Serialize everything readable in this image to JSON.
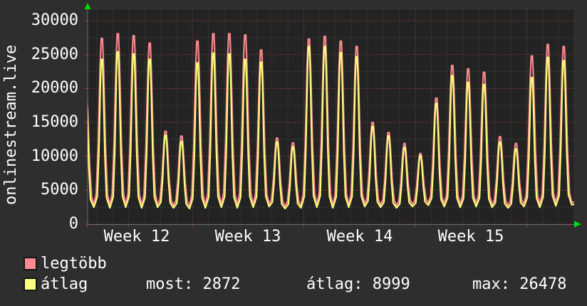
{
  "title": "onlinestream.live",
  "legend": {
    "series": [
      {
        "label": "legtöbb",
        "swatch_color": "#fb8a8e"
      },
      {
        "label": "átlag",
        "swatch_color": "#fdfd82"
      }
    ],
    "stats": [
      {
        "label": "most",
        "value": 2872,
        "text": "most: 2872"
      },
      {
        "label": "átlag",
        "value": 8999,
        "text": "átlag: 8999"
      },
      {
        "label": "max",
        "value": 26478,
        "text": "max: 26478"
      }
    ]
  },
  "chart_data": {
    "type": "line",
    "title": "onlinestream.live",
    "xlabel": "",
    "ylabel": "onlinestream.live",
    "x_tick_labels": [
      "Week 12",
      "Week 13",
      "Week 14",
      "Week 15"
    ],
    "y_ticks": [
      0,
      5000,
      10000,
      15000,
      20000,
      25000,
      30000
    ],
    "ylim": [
      0,
      31700
    ],
    "grid": {
      "y_minor_step": 2500,
      "y_major_step": 5000,
      "x_minor": "1 day",
      "x_major": "1 week",
      "style": "dotted"
    },
    "legend_position": "bottom-left",
    "x_span_days": 31,
    "series": [
      {
        "name": "legtöbb",
        "role": "daily maximum",
        "color": "#f5888c",
        "day_peaks": [
          19500,
          27400,
          28100,
          27800,
          26700,
          13700,
          13000,
          27000,
          28100,
          28100,
          27900,
          25700,
          12700,
          12000,
          27300,
          27700,
          27000,
          26200,
          15000,
          13500,
          11900,
          10400,
          18600,
          23400,
          22900,
          22400,
          12900,
          11900,
          24800,
          26500,
          26200
        ]
      },
      {
        "name": "átlag",
        "role": "daily average",
        "color": "#fbfb7b",
        "day_peaks": [
          18500,
          24300,
          25400,
          25100,
          24300,
          13100,
          12200,
          23800,
          25200,
          25100,
          24300,
          23900,
          12100,
          11400,
          26200,
          26200,
          25300,
          24700,
          14400,
          13000,
          11300,
          10100,
          17800,
          21900,
          20900,
          20600,
          12100,
          11100,
          21600,
          24600,
          24100
        ]
      }
    ],
    "night_troughs": [
      2500,
      2400,
      2500,
      2400,
      2500,
      2400,
      2300,
      2400,
      2500,
      2400,
      2500,
      2600,
      2300,
      2400,
      2500,
      2400,
      2500,
      2600,
      2500,
      2400,
      2600,
      2800,
      2600,
      2500,
      2600,
      2500,
      2400,
      2600,
      2500,
      2700,
      2872
    ],
    "current_value": 2872,
    "colors": {
      "outer_bg": "#2e2e2e",
      "plot_bg": "#232323",
      "grid_minor": "#4b4b4b",
      "grid_major": "#a84444",
      "axis": "#6e6e6e",
      "border_dash": "#454545",
      "arrow": "#00dd00",
      "text": "#ffffff"
    }
  }
}
